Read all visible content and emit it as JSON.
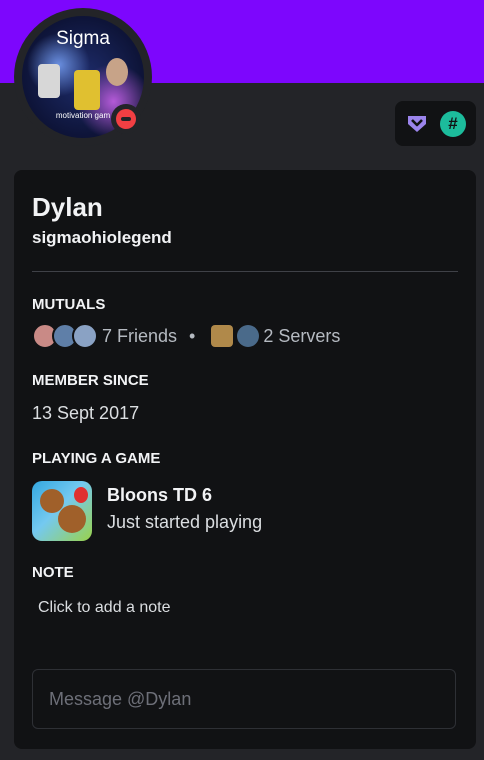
{
  "avatar": {
    "title": "Sigma",
    "caption": "motivation gam"
  },
  "status": {
    "state": "do-not-disturb",
    "color": "#f23f43"
  },
  "colors": {
    "banner": "#7d06fd",
    "hypesquad": "#9b84ec",
    "hashtag_badge": "#1cbc9c"
  },
  "badges": [
    {
      "icon": "hypesquad-icon"
    },
    {
      "icon": "hashtag-icon",
      "symbol": "#"
    }
  ],
  "profile": {
    "display_name": "Dylan",
    "username": "sigmaohiolegend"
  },
  "mutuals": {
    "header": "MUTUALS",
    "friends_label": "7 Friends",
    "separator": "•",
    "servers_label": "2 Servers"
  },
  "member_since": {
    "header": "MEMBER SINCE",
    "date": "13 Sept 2017"
  },
  "activity": {
    "header": "PLAYING A GAME",
    "game_title": "Bloons TD 6",
    "game_status": "Just started playing"
  },
  "note": {
    "header": "NOTE",
    "placeholder": "Click to add a note"
  },
  "message": {
    "placeholder": "Message @Dylan",
    "value": ""
  }
}
